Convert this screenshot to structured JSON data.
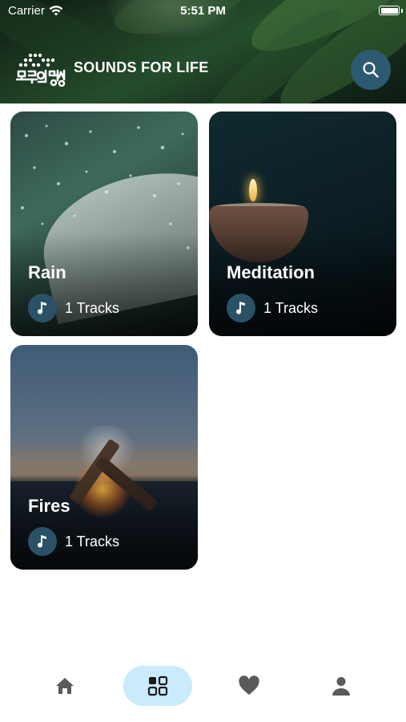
{
  "status_bar": {
    "carrier": "Carrier",
    "time": "5:51 PM"
  },
  "header": {
    "app_title": "SOUNDS FOR LIFE",
    "logo_text": "모두의명상"
  },
  "cards": [
    {
      "title": "Rain",
      "tracks": "1 Tracks"
    },
    {
      "title": "Meditation",
      "tracks": "1 Tracks"
    },
    {
      "title": "Fires",
      "tracks": "1 Tracks"
    }
  ],
  "tab_bar": {
    "tabs": [
      {
        "icon": "home-icon"
      },
      {
        "icon": "grid-icon",
        "active": true
      },
      {
        "icon": "heart-icon"
      },
      {
        "icon": "profile-icon"
      }
    ],
    "active_color": "#c9ebfb",
    "icon_color": "#5a5a5a"
  },
  "colors": {
    "accent": "#2c5a70",
    "note_circle": "#2b5166"
  }
}
